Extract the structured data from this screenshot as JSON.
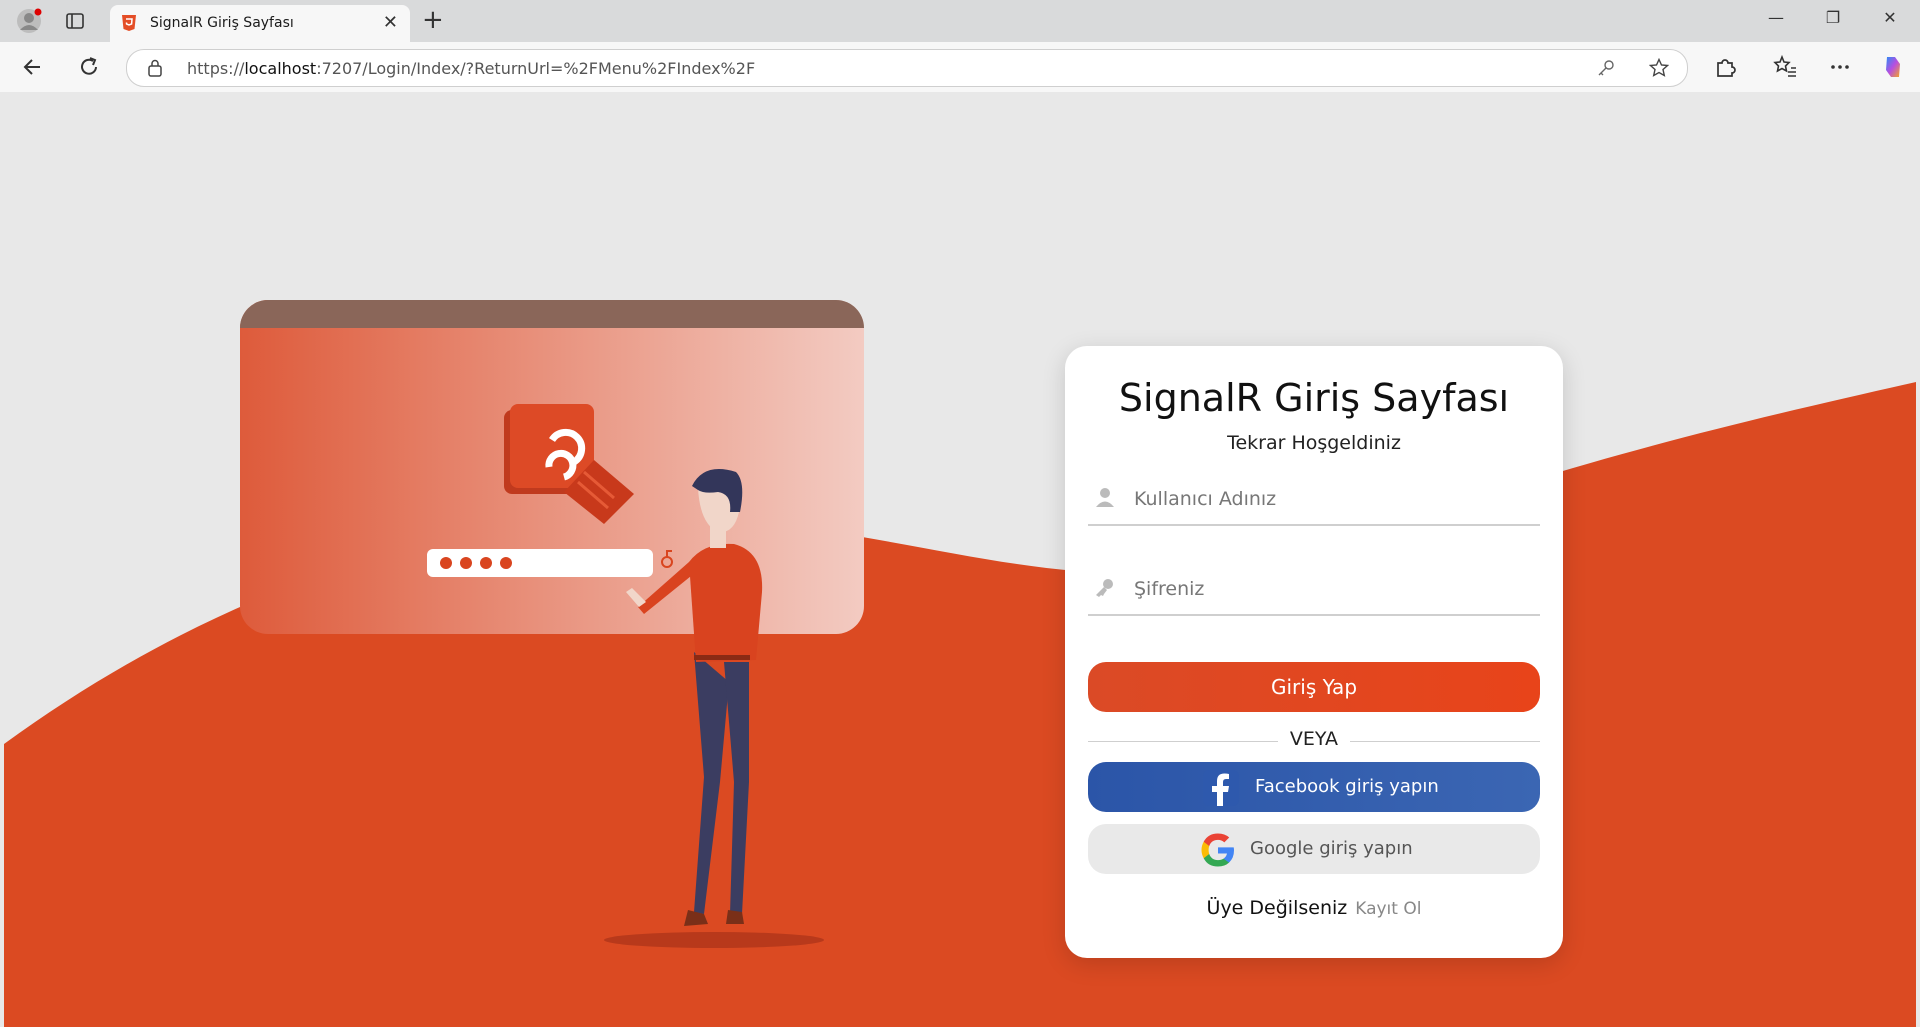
{
  "browser": {
    "tab_title": "SignalR Giriş Sayfası",
    "new_tab": "+",
    "url_prefix": "https://",
    "url_host": "localhost",
    "url_rest": ":7207/Login/Index/?ReturnUrl=%2FMenu%2FIndex%2F",
    "window_buttons": {
      "minimize": "—",
      "restore": "❐",
      "close": "✕"
    }
  },
  "login": {
    "title": "SignalR Giriş Sayfası",
    "subtitle": "Tekrar Hoşgeldiniz",
    "username_placeholder": "Kullanıcı Adınız",
    "password_placeholder": "Şifreniz",
    "submit_label": "Giriş Yap",
    "divider_label": "VEYA",
    "facebook_label": "Facebook giriş yapın",
    "google_label": "Google giriş yapın",
    "register_text": "Üye Değilseniz",
    "register_link": "Kayıt Ol"
  },
  "colors": {
    "accent": "#db4a26",
    "facebook": "#2b55a8",
    "background": "#e8e8e8"
  },
  "icons": [
    "profile-icon",
    "tabs-icon",
    "html5-icon",
    "back-icon",
    "refresh-icon",
    "lock-icon",
    "key-icon",
    "star-icon",
    "extensions-icon",
    "favorites-icon",
    "more-icon",
    "copilot-icon",
    "user-icon",
    "facebook-icon",
    "google-icon"
  ]
}
